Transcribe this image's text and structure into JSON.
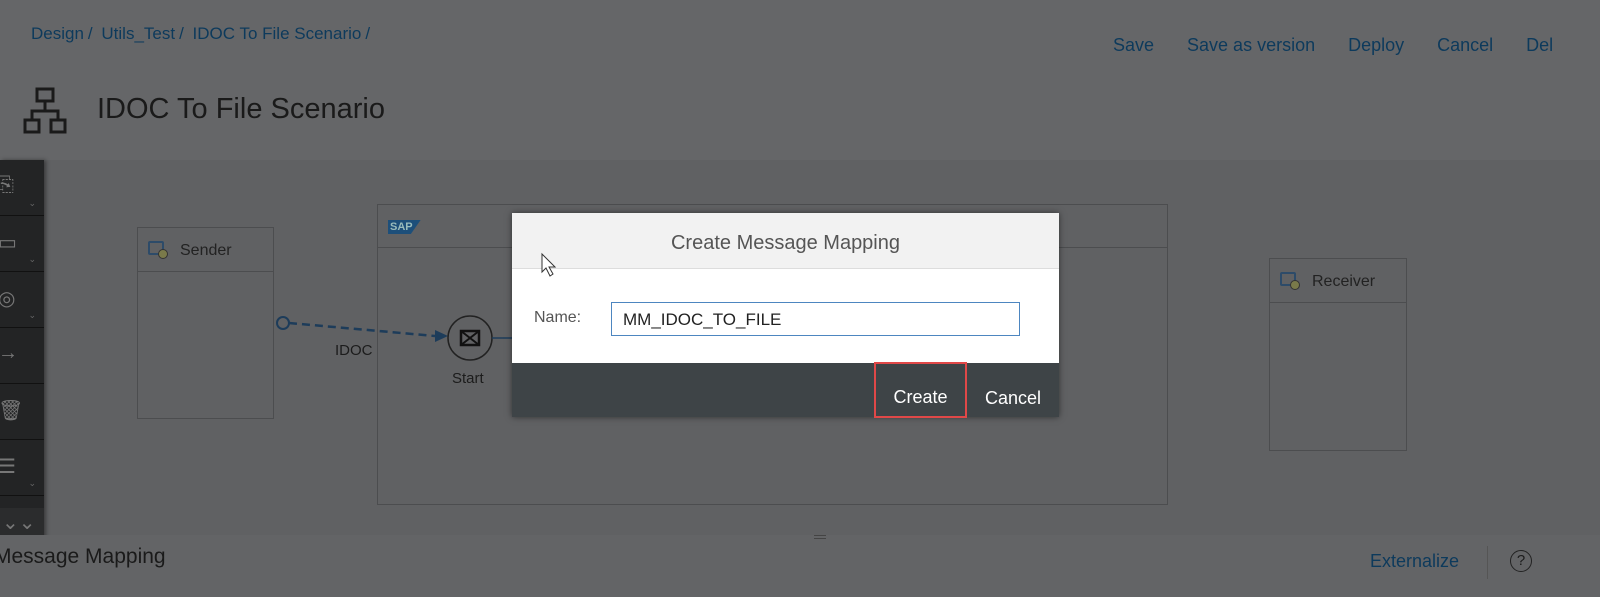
{
  "breadcrumb": [
    "Design",
    "Utils_Test",
    "IDOC To File Scenario"
  ],
  "header_actions": [
    "Save",
    "Save as version",
    "Deploy",
    "Cancel",
    "Del"
  ],
  "page_title": "IDOC To File Scenario",
  "diagram": {
    "sender": "Sender",
    "receiver": "Receiver",
    "connection_label": "IDOC",
    "start_event": "Start",
    "pool_logo": "SAP"
  },
  "dialog": {
    "title": "Create Message Mapping",
    "name_label": "Name:",
    "name_value": "MM_IDOC_TO_FILE",
    "create_label": "Create",
    "cancel_label": "Cancel"
  },
  "footer": {
    "panel_title": "Message Mapping",
    "externalize": "Externalize",
    "help": "?"
  }
}
